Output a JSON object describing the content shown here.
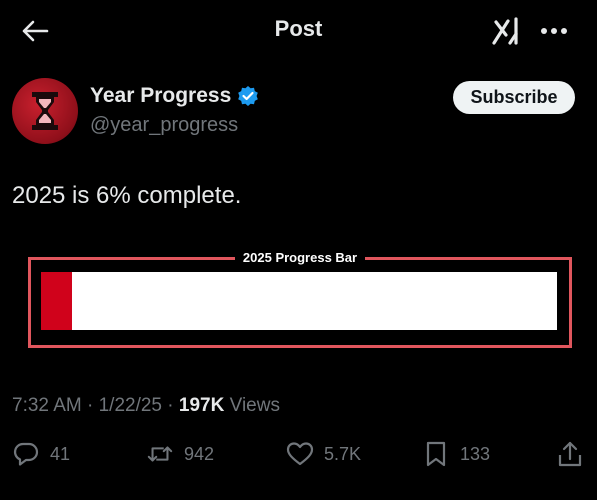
{
  "header": {
    "title": "Post",
    "back_icon": "arrow-left-icon",
    "grok_icon": "grok-icon",
    "more_icon": "more-horizontal-icon"
  },
  "author": {
    "name": "Year Progress",
    "handle": "@year_progress",
    "verified": true,
    "verified_color": "#1d9bf0",
    "avatar_icon": "hourglass-icon",
    "avatar_color": "#c8202e",
    "subscribe_label": "Subscribe"
  },
  "post": {
    "text": "2025 is 6% complete.",
    "progress": {
      "label": "2025 Progress Bar",
      "fraction": 0.06,
      "fill_color": "#d0021b",
      "border_color": "#e0565d"
    }
  },
  "meta": {
    "time": "7:32 AM",
    "separator": "·",
    "date": "1/22/25",
    "views_count": "197K",
    "views_label": "Views"
  },
  "actions": {
    "replies": "41",
    "reposts": "942",
    "likes": "5.7K",
    "bookmarks": "133"
  }
}
